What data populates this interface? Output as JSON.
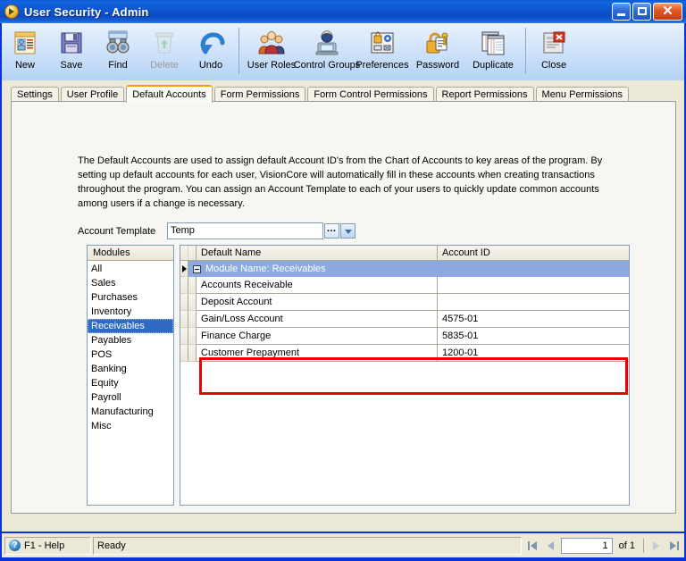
{
  "window": {
    "title": "User Security - Admin",
    "icon": "app-globe-icon",
    "minimize_label": "",
    "maximize_label": "",
    "close_label": "✕"
  },
  "toolbar": {
    "groups": [
      {
        "buttons": [
          {
            "label": "New",
            "icon": "new-document-icon",
            "enabled": true
          },
          {
            "label": "Save",
            "icon": "floppy-disk-icon",
            "enabled": true
          },
          {
            "label": "Find",
            "icon": "binoculars-icon",
            "enabled": true
          },
          {
            "label": "Delete",
            "icon": "recycle-bin-icon",
            "enabled": false
          },
          {
            "label": "Undo",
            "icon": "undo-arrow-icon",
            "enabled": true
          }
        ]
      },
      {
        "buttons": [
          {
            "label": "User Roles",
            "icon": "users-group-icon",
            "enabled": true
          },
          {
            "label": "Control Groups",
            "icon": "user-computer-icon",
            "enabled": true
          },
          {
            "label": "Preferences",
            "icon": "preferences-panel-icon",
            "enabled": true
          },
          {
            "label": "Password",
            "icon": "padlock-key-icon",
            "enabled": true
          },
          {
            "label": "Duplicate",
            "icon": "duplicate-pages-icon",
            "enabled": true
          }
        ]
      },
      {
        "buttons": [
          {
            "label": "Close",
            "icon": "close-document-icon",
            "enabled": true
          }
        ]
      }
    ]
  },
  "tabs": [
    {
      "label": "Settings",
      "active": false
    },
    {
      "label": "User Profile",
      "active": false
    },
    {
      "label": "Default Accounts",
      "active": true
    },
    {
      "label": "Form Permissions",
      "active": false
    },
    {
      "label": "Form Control Permissions",
      "active": false
    },
    {
      "label": "Report Permissions",
      "active": false
    },
    {
      "label": "Menu Permissions",
      "active": false
    }
  ],
  "page": {
    "description": "The Default Accounts are used to assign default Account ID's from the Chart of Accounts to key areas of the program.  By setting up default accounts for each user, VisionCore will automatically fill in these accounts when creating transactions throughout the program.  You can assign an Account Template to each of your users to quickly update common accounts among users if a change is necessary.",
    "account_template": {
      "label": "Account Template",
      "value": "Temp",
      "placeholder": "",
      "ellipsis_label": "…",
      "dropdown_icon": "chevron-down-icon"
    },
    "modules": {
      "header": "Modules",
      "selected": "Receivables",
      "items": [
        "All",
        "Sales",
        "Purchases",
        "Inventory",
        "Receivables",
        "Payables",
        "POS",
        "Banking",
        "Equity",
        "Payroll",
        "Manufacturing",
        "Misc"
      ]
    },
    "grid": {
      "columns": [
        "Default Name",
        "Account ID"
      ],
      "group_row": "Module Name: Receivables",
      "rows": [
        {
          "name": "Accounts Receivable",
          "account_id": "",
          "highlighted": true
        },
        {
          "name": "Deposit Account",
          "account_id": "",
          "highlighted": true
        },
        {
          "name": "Gain/Loss Account",
          "account_id": "4575-01",
          "highlighted": false
        },
        {
          "name": "Finance Charge",
          "account_id": "5835-01",
          "highlighted": false
        },
        {
          "name": "Customer Prepayment",
          "account_id": "1200-01",
          "highlighted": false
        }
      ],
      "highlight_color": "#ee0000"
    }
  },
  "statusbar": {
    "help_icon": "question-mark-icon",
    "help_label": "F1 - Help",
    "status": "Ready",
    "nav": {
      "first_icon": "first-record-icon",
      "prev_icon": "previous-record-icon",
      "page_value": "1",
      "of_label": "of  1",
      "next_icon": "next-record-icon",
      "last_icon": "last-record-icon"
    }
  },
  "colors": {
    "title_blue": "#0c4bc4",
    "selection_blue": "#316ac5",
    "group_row_blue": "#8ca9e0",
    "active_tab_accent": "#f5a100",
    "highlight_red": "#ee0000",
    "chrome": "#ece9d8"
  }
}
